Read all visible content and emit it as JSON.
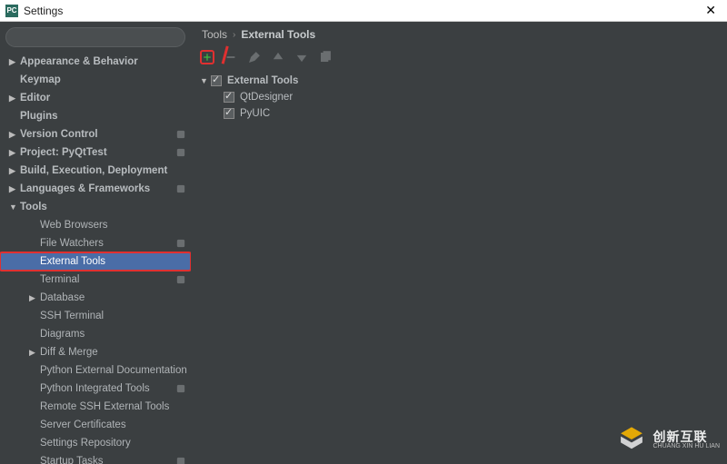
{
  "window": {
    "title": "Settings"
  },
  "breadcrumb": {
    "root": "Tools",
    "current": "External Tools"
  },
  "toolbar": {
    "add": "add",
    "remove": "remove",
    "edit": "edit",
    "up": "up",
    "down": "down",
    "copy": "copy"
  },
  "tools_tree": {
    "group": "External Tools",
    "items": [
      "QtDesigner",
      "PyUIC"
    ]
  },
  "sidebar": {
    "items": [
      {
        "label": "Appearance & Behavior",
        "arrow": "▶",
        "top": true
      },
      {
        "label": "Keymap",
        "top": true
      },
      {
        "label": "Editor",
        "arrow": "▶",
        "top": true
      },
      {
        "label": "Plugins",
        "top": true
      },
      {
        "label": "Version Control",
        "arrow": "▶",
        "top": true,
        "badge": true
      },
      {
        "label": "Project: PyQtTest",
        "arrow": "▶",
        "top": true,
        "badge": true
      },
      {
        "label": "Build, Execution, Deployment",
        "arrow": "▶",
        "top": true
      },
      {
        "label": "Languages & Frameworks",
        "arrow": "▶",
        "top": true,
        "badge": true
      },
      {
        "label": "Tools",
        "arrow": "▼",
        "top": true
      },
      {
        "label": "Web Browsers",
        "sub": true
      },
      {
        "label": "File Watchers",
        "sub": true,
        "badge": true
      },
      {
        "label": "External Tools",
        "sub": true,
        "selected": true,
        "redbox": true
      },
      {
        "label": "Terminal",
        "sub": true,
        "badge": true
      },
      {
        "label": "Database",
        "sub": true,
        "arrow": "▶"
      },
      {
        "label": "SSH Terminal",
        "sub": true
      },
      {
        "label": "Diagrams",
        "sub": true
      },
      {
        "label": "Diff & Merge",
        "sub": true,
        "arrow": "▶"
      },
      {
        "label": "Python External Documentation",
        "sub": true
      },
      {
        "label": "Python Integrated Tools",
        "sub": true,
        "badge": true
      },
      {
        "label": "Remote SSH External Tools",
        "sub": true
      },
      {
        "label": "Server Certificates",
        "sub": true
      },
      {
        "label": "Settings Repository",
        "sub": true
      },
      {
        "label": "Startup Tasks",
        "sub": true,
        "badge": true
      }
    ]
  },
  "watermark": {
    "brand": "创新互联",
    "sub": "CHUANG XIN HU LIAN"
  }
}
